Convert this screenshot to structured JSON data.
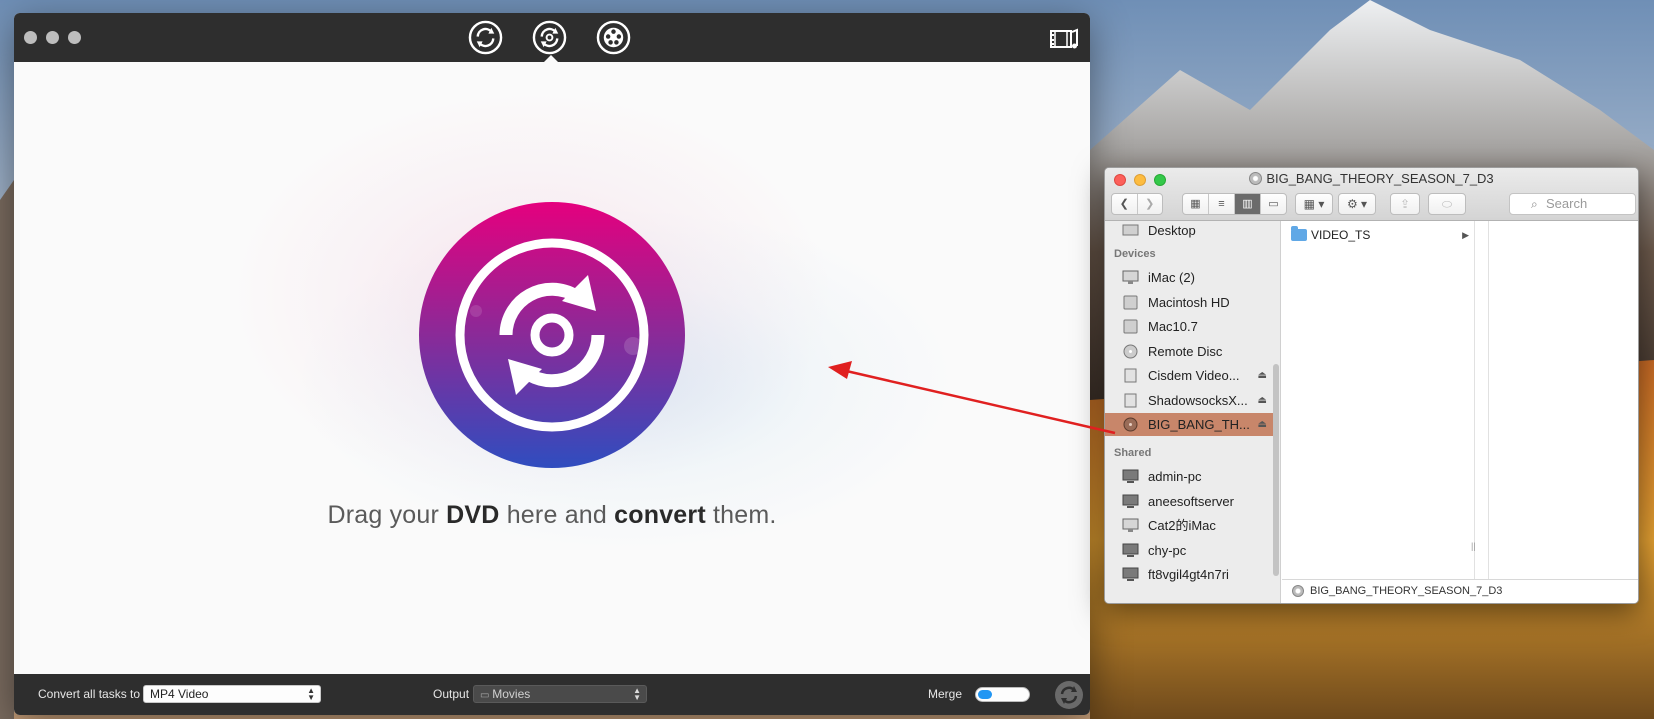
{
  "converter": {
    "toolbar_icons": [
      "convert-video-icon",
      "dvd-rip-icon",
      "burn-film-icon"
    ],
    "drop_zone": {
      "text_prefix": "Drag your ",
      "text_bold1": "DVD",
      "text_middle": " here and ",
      "text_bold2": "convert",
      "text_suffix": " them."
    },
    "bottom_bar": {
      "convert_label": "Convert all tasks to",
      "format_value": "MP4 Video",
      "output_label": "Output",
      "output_value": "Movies",
      "merge_label": "Merge",
      "merge_on": false
    }
  },
  "finder": {
    "title": "BIG_BANG_THEORY_SEASON_7_D3",
    "search_placeholder": "Search",
    "sidebar": {
      "top_item": "Desktop",
      "devices_heading": "Devices",
      "devices": [
        {
          "label": "iMac (2)",
          "icon": "imac-icon",
          "eject": false
        },
        {
          "label": "Macintosh HD",
          "icon": "hard-drive-icon",
          "eject": false
        },
        {
          "label": "Mac10.7",
          "icon": "hard-drive-icon",
          "eject": false
        },
        {
          "label": "Remote Disc",
          "icon": "disc-icon",
          "eject": false
        },
        {
          "label": "Cisdem Video...",
          "icon": "volume-icon",
          "eject": true
        },
        {
          "label": "ShadowsocksX...",
          "icon": "volume-icon",
          "eject": true
        },
        {
          "label": "BIG_BANG_TH...",
          "icon": "dvd-disc-icon",
          "eject": true,
          "selected": true
        }
      ],
      "shared_heading": "Shared",
      "shared": [
        {
          "label": "admin-pc",
          "icon": "network-pc-icon"
        },
        {
          "label": "aneesoftserver",
          "icon": "network-pc-icon"
        },
        {
          "label": "Cat2的iMac",
          "icon": "imac-icon"
        },
        {
          "label": "chy-pc",
          "icon": "network-pc-icon"
        },
        {
          "label": "ft8vgil4gt4n7ri",
          "icon": "network-pc-icon"
        }
      ]
    },
    "column1_items": [
      {
        "label": "VIDEO_TS",
        "icon": "folder-icon"
      }
    ],
    "path_bar": "BIG_BANG_THEORY_SEASON_7_D3"
  },
  "colors": {
    "disc_gradient_top": "#e5007e",
    "disc_gradient_bottom": "#2f4dbf",
    "selection": "#c8866a",
    "arrow": "#e02020",
    "toggle_knob": "#2196f3"
  }
}
